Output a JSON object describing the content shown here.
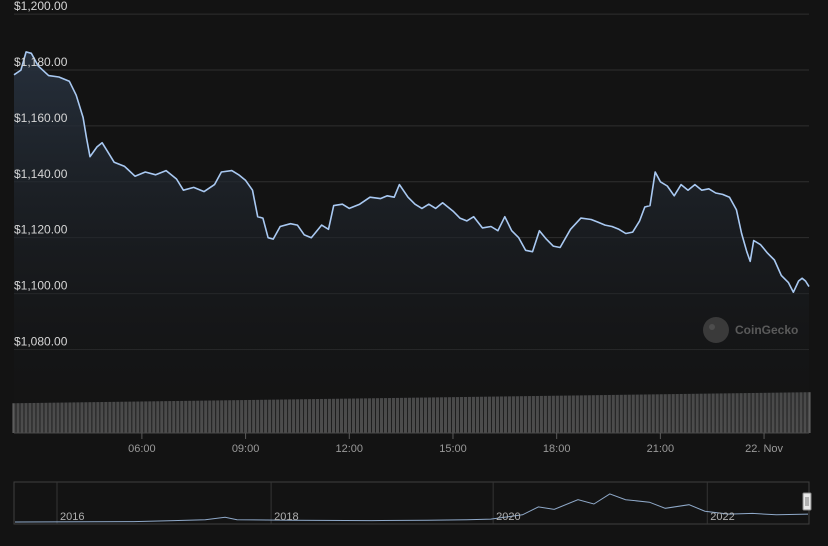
{
  "chart_data": {
    "type": "area",
    "y_axis": {
      "ticks": [
        1080,
        1100,
        1120,
        1140,
        1160,
        1180,
        1200
      ],
      "tick_labels": [
        "$1,080.00",
        "$1,100.00",
        "$1,120.00",
        "$1,140.00",
        "$1,160.00",
        "$1,180.00",
        "$1,200.00"
      ],
      "range": [
        1073,
        1204
      ]
    },
    "x_axis": {
      "tick_labels": [
        "06:00",
        "09:00",
        "12:00",
        "15:00",
        "18:00",
        "21:00",
        "22. Nov"
      ],
      "tick_hours": [
        6,
        9,
        12,
        15,
        18,
        21,
        24
      ],
      "range_hours": [
        2.3,
        25.3
      ]
    },
    "price": {
      "points": [
        [
          2.3,
          1178.3
        ],
        [
          2.5,
          1180.0
        ],
        [
          2.65,
          1186.5
        ],
        [
          2.8,
          1186.0
        ],
        [
          3.0,
          1181.5
        ],
        [
          3.3,
          1178.0
        ],
        [
          3.6,
          1177.5
        ],
        [
          3.9,
          1176.0
        ],
        [
          4.1,
          1171.0
        ],
        [
          4.3,
          1163.0
        ],
        [
          4.4,
          1155.5
        ],
        [
          4.5,
          1149.0
        ],
        [
          4.7,
          1152.5
        ],
        [
          4.85,
          1154.0
        ],
        [
          5.0,
          1151.0
        ],
        [
          5.2,
          1147.0
        ],
        [
          5.5,
          1145.5
        ],
        [
          5.8,
          1142.0
        ],
        [
          6.1,
          1143.5
        ],
        [
          6.4,
          1142.5
        ],
        [
          6.7,
          1144.0
        ],
        [
          7.0,
          1141.0
        ],
        [
          7.2,
          1137.0
        ],
        [
          7.5,
          1138.0
        ],
        [
          7.8,
          1136.5
        ],
        [
          8.1,
          1139.0
        ],
        [
          8.3,
          1143.5
        ],
        [
          8.6,
          1144.0
        ],
        [
          8.8,
          1142.5
        ],
        [
          9.0,
          1140.5
        ],
        [
          9.2,
          1137.0
        ],
        [
          9.35,
          1127.5
        ],
        [
          9.5,
          1127.0
        ],
        [
          9.65,
          1120.0
        ],
        [
          9.8,
          1119.5
        ],
        [
          10.0,
          1124.0
        ],
        [
          10.3,
          1125.0
        ],
        [
          10.5,
          1124.5
        ],
        [
          10.7,
          1121.0
        ],
        [
          10.9,
          1120.0
        ],
        [
          11.2,
          1124.5
        ],
        [
          11.4,
          1123.0
        ],
        [
          11.55,
          1131.5
        ],
        [
          11.8,
          1132.0
        ],
        [
          12.0,
          1130.5
        ],
        [
          12.3,
          1132.0
        ],
        [
          12.6,
          1134.5
        ],
        [
          12.9,
          1134.0
        ],
        [
          13.1,
          1135.0
        ],
        [
          13.3,
          1134.5
        ],
        [
          13.45,
          1139.0
        ],
        [
          13.7,
          1134.5
        ],
        [
          13.9,
          1132.0
        ],
        [
          14.1,
          1130.5
        ],
        [
          14.3,
          1132.0
        ],
        [
          14.5,
          1130.5
        ],
        [
          14.7,
          1132.5
        ],
        [
          15.0,
          1129.5
        ],
        [
          15.2,
          1127.0
        ],
        [
          15.4,
          1126.0
        ],
        [
          15.6,
          1127.5
        ],
        [
          15.85,
          1123.5
        ],
        [
          16.1,
          1124.0
        ],
        [
          16.3,
          1122.5
        ],
        [
          16.5,
          1127.5
        ],
        [
          16.7,
          1122.5
        ],
        [
          16.9,
          1120.0
        ],
        [
          17.1,
          1115.5
        ],
        [
          17.3,
          1115.0
        ],
        [
          17.5,
          1122.5
        ],
        [
          17.7,
          1119.5
        ],
        [
          17.9,
          1117.0
        ],
        [
          18.1,
          1116.5
        ],
        [
          18.4,
          1123.0
        ],
        [
          18.7,
          1127.0
        ],
        [
          19.0,
          1126.5
        ],
        [
          19.2,
          1125.5
        ],
        [
          19.4,
          1124.5
        ],
        [
          19.6,
          1124.0
        ],
        [
          19.8,
          1123.0
        ],
        [
          20.0,
          1121.5
        ],
        [
          20.2,
          1122.0
        ],
        [
          20.4,
          1126.0
        ],
        [
          20.55,
          1131.0
        ],
        [
          20.7,
          1131.5
        ],
        [
          20.85,
          1143.5
        ],
        [
          21.0,
          1140.0
        ],
        [
          21.2,
          1138.5
        ],
        [
          21.4,
          1135.0
        ],
        [
          21.6,
          1139.0
        ],
        [
          21.8,
          1137.0
        ],
        [
          22.0,
          1139.0
        ],
        [
          22.2,
          1137.0
        ],
        [
          22.4,
          1137.5
        ],
        [
          22.6,
          1136.0
        ],
        [
          22.8,
          1135.5
        ],
        [
          23.0,
          1134.5
        ],
        [
          23.2,
          1130.0
        ],
        [
          23.35,
          1121.5
        ],
        [
          23.5,
          1115.0
        ],
        [
          23.6,
          1111.5
        ],
        [
          23.7,
          1119.0
        ],
        [
          23.9,
          1117.5
        ],
        [
          24.1,
          1114.5
        ],
        [
          24.3,
          1112.0
        ],
        [
          24.5,
          1106.5
        ],
        [
          24.7,
          1104.0
        ],
        [
          24.85,
          1100.5
        ],
        [
          25.0,
          1104.5
        ],
        [
          25.1,
          1105.5
        ],
        [
          25.2,
          1104.5
        ],
        [
          25.3,
          1102.5
        ]
      ]
    },
    "volume": {
      "start_hours": 2.3,
      "end_hours": 25.3,
      "start_level": 0.62,
      "end_level": 0.85
    },
    "navigator": {
      "year_labels": [
        "2016",
        "2018",
        "2020",
        "2022"
      ],
      "year_positions": [
        0.0,
        0.27,
        0.55,
        0.82
      ],
      "series": [
        [
          0.0,
          0.0
        ],
        [
          0.15,
          0.01
        ],
        [
          0.2,
          0.04
        ],
        [
          0.24,
          0.06
        ],
        [
          0.265,
          0.13
        ],
        [
          0.28,
          0.06
        ],
        [
          0.35,
          0.05
        ],
        [
          0.45,
          0.04
        ],
        [
          0.52,
          0.05
        ],
        [
          0.57,
          0.06
        ],
        [
          0.6,
          0.08
        ],
        [
          0.64,
          0.2
        ],
        [
          0.66,
          0.42
        ],
        [
          0.68,
          0.35
        ],
        [
          0.71,
          0.62
        ],
        [
          0.73,
          0.5
        ],
        [
          0.75,
          0.78
        ],
        [
          0.77,
          0.62
        ],
        [
          0.8,
          0.55
        ],
        [
          0.82,
          0.38
        ],
        [
          0.85,
          0.48
        ],
        [
          0.87,
          0.3
        ],
        [
          0.9,
          0.22
        ],
        [
          0.93,
          0.24
        ],
        [
          0.96,
          0.2
        ],
        [
          1.0,
          0.22
        ]
      ]
    }
  },
  "watermark": {
    "text": "CoinGecko"
  }
}
